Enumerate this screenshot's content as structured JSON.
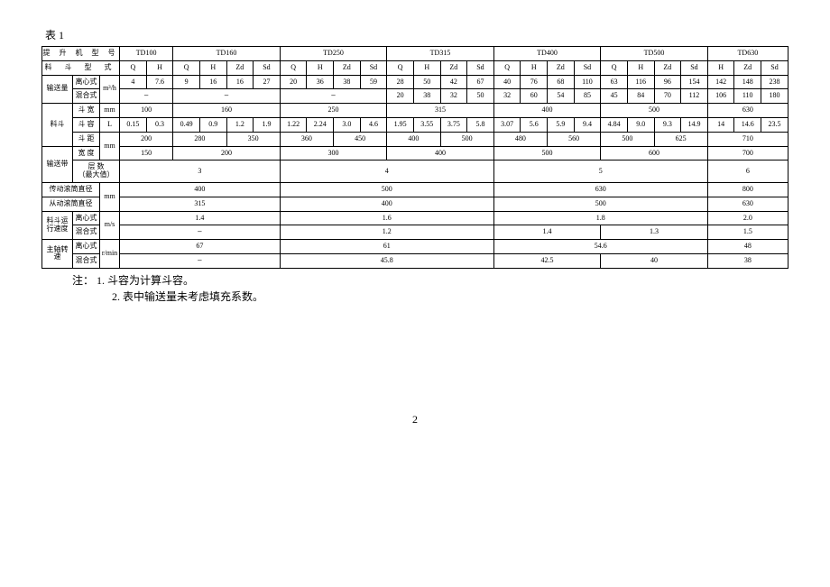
{
  "title": "表 1",
  "headers": {
    "model": "提 升 机 型 号",
    "bucket_type": "料  斗  型  式",
    "models": [
      "TD100",
      "TD160",
      "TD250",
      "TD315",
      "TD400",
      "TD500",
      "TD630"
    ]
  },
  "sub": {
    "Q": "Q",
    "H": "H",
    "Zd": "Zd",
    "Sd": "Sd"
  },
  "rows": {
    "capacity_label": "输送量",
    "centrifugal": "离心式",
    "mixed": "混合式",
    "unit_m3h": "m³/h",
    "bucket": "料斗",
    "width": "斗  宽",
    "vol": "斗  容",
    "pitch": "斗  距",
    "belt": "输送带",
    "belt_width": "宽  度",
    "layers": "层  数\n（最大值）",
    "drive_drum": "传动滚筒直径",
    "driven_drum": "从动滚筒直径",
    "speed": "料斗运\n行速度",
    "shaft": "主轴转\n速",
    "mm": "mm",
    "L": "L",
    "ms": "m/s",
    "rmin": "r/min"
  },
  "data": {
    "cap_cen": {
      "td100": [
        "4",
        "7.6"
      ],
      "td160": [
        "9",
        "16",
        "16",
        "27"
      ],
      "td250": [
        "20",
        "36",
        "38",
        "59"
      ],
      "td315": [
        "28",
        "50",
        "42",
        "67"
      ],
      "td400": [
        "40",
        "76",
        "68",
        "110"
      ],
      "td500": [
        "63",
        "116",
        "96",
        "154"
      ],
      "td630": [
        "142",
        "148",
        "238"
      ]
    },
    "cap_mix": {
      "td100": "–",
      "td160": "–",
      "td250": "–",
      "td315": [
        "20",
        "38",
        "32",
        "50"
      ],
      "td400": [
        "32",
        "60",
        "54",
        "85"
      ],
      "td500": [
        "45",
        "84",
        "70",
        "112"
      ],
      "td630": [
        "106",
        "110",
        "180"
      ]
    },
    "width": {
      "td100": "100",
      "td160": "160",
      "td250": "250",
      "td315": "315",
      "td400": "400",
      "td500": "500",
      "td630": "630"
    },
    "vol": {
      "td100": [
        "0.15",
        "0.3"
      ],
      "td160": [
        "0.49",
        "0.9",
        "1.2",
        "1.9"
      ],
      "td250": [
        "1.22",
        "2.24",
        "3.0",
        "4.6"
      ],
      "td315": [
        "1.95",
        "3.55",
        "3.75",
        "5.8"
      ],
      "td400": [
        "3.07",
        "5.6",
        "5.9",
        "9.4"
      ],
      "td500": [
        "4.84",
        "9.0",
        "9.3",
        "14.9"
      ],
      "td630": [
        "14",
        "14.6",
        "23.5"
      ]
    },
    "pitch": {
      "td100": "200",
      "td160": [
        "280",
        "350"
      ],
      "td250": [
        "360",
        "450"
      ],
      "td315": [
        "400",
        "500"
      ],
      "td400": [
        "480",
        "560"
      ],
      "td500": [
        "500",
        "625"
      ],
      "td630": "710"
    },
    "belt_width": {
      "td100": "150",
      "td160_250": "200",
      "td250": "300",
      "td315_400": "400",
      "td400": "500",
      "td500": "600",
      "td630": "700"
    },
    "layers": {
      "g1": "3",
      "g2": "4",
      "g3": "5",
      "g4": "6"
    },
    "drive_drum": {
      "g1": "400",
      "g2": "500",
      "g3": "630",
      "g4": "800"
    },
    "driven_drum": {
      "g1": "315",
      "g2": "400",
      "g3": "500",
      "g4": "630"
    },
    "speed_cen": {
      "g1": "1.4",
      "g2": "1.6",
      "g3": "1.8",
      "g4": "2.0"
    },
    "speed_mix": {
      "g1": "–",
      "g2": "1.2",
      "g3a": "1.4",
      "g3b": "1.3",
      "g4": "1.5"
    },
    "shaft_cen": {
      "g1": "67",
      "g2": "61",
      "g3": "54.6",
      "g4": "48"
    },
    "shaft_mix": {
      "g1": "–",
      "g2": "45.8",
      "g3a": "42.5",
      "g3b": "40",
      "g4": "38"
    }
  },
  "notes": {
    "n1": "注：  1.  斗容为计算斗容。",
    "n2": "2.    表中输送量未考虑填充系数。"
  },
  "page": "2"
}
